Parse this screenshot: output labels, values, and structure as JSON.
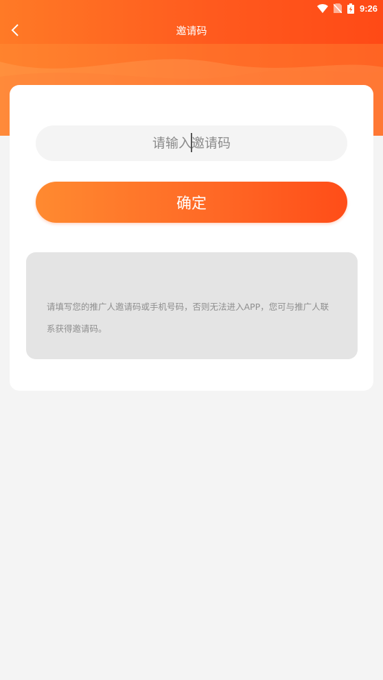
{
  "status_bar": {
    "time": "9:26",
    "icons": [
      "wifi-icon",
      "no-sim-icon",
      "battery-charging-icon"
    ]
  },
  "nav": {
    "title": "邀请码",
    "back_icon": "chevron-left-icon"
  },
  "form": {
    "input_placeholder": "请输入邀请码",
    "input_value": "",
    "confirm_label": "确定"
  },
  "notice": {
    "text": "请填写您的推广人邀请码或手机号码，否则无法进入APP，您可与推广人联系获得邀请码。"
  },
  "colors": {
    "accent_start": "#ff8a30",
    "accent_end": "#ff4d18",
    "page_background": "#f4f4f4",
    "card_background": "#ffffff",
    "notice_background": "#e4e4e4"
  }
}
